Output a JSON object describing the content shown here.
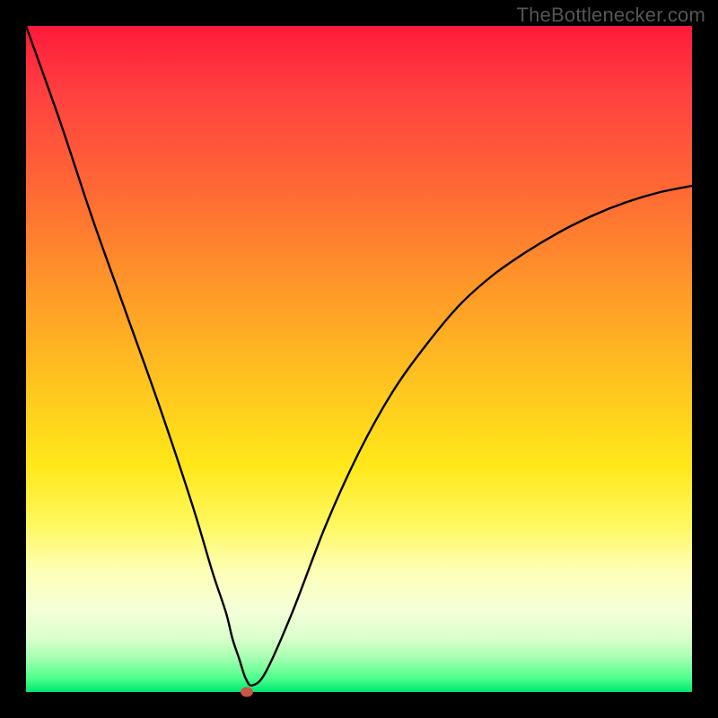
{
  "watermark": "TheBottlenecker.com",
  "chart_data": {
    "type": "line",
    "title": "",
    "xlabel": "",
    "ylabel": "",
    "xlim": [
      0,
      100
    ],
    "ylim": [
      0,
      100
    ],
    "series": [
      {
        "name": "bottleneck-curve",
        "x": [
          0,
          5,
          10,
          15,
          20,
          25,
          28,
          30,
          31,
          32,
          33,
          34,
          36,
          40,
          45,
          50,
          55,
          60,
          65,
          70,
          75,
          80,
          85,
          90,
          95,
          100
        ],
        "values": [
          100,
          86,
          71,
          57,
          43,
          28,
          18,
          12,
          8,
          5,
          2,
          1,
          3,
          12,
          25,
          36,
          45,
          52,
          58,
          62.5,
          66,
          69,
          71.5,
          73.5,
          75,
          76
        ]
      }
    ],
    "marker": {
      "x": 33.2,
      "y": 0
    },
    "gradient_stops": [
      {
        "pos": 0.0,
        "color": "#ff1a3a"
      },
      {
        "pos": 0.25,
        "color": "#ff6a34"
      },
      {
        "pos": 0.55,
        "color": "#ffc81e"
      },
      {
        "pos": 0.82,
        "color": "#fdffb8"
      },
      {
        "pos": 1.0,
        "color": "#00e66e"
      }
    ]
  }
}
